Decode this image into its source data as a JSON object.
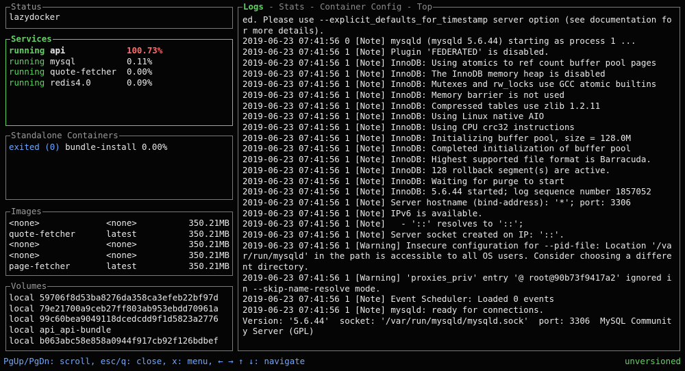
{
  "status": {
    "title": "Status",
    "project": "lazydocker"
  },
  "services": {
    "title": "Services",
    "rows": [
      {
        "state": "running",
        "name": "api",
        "cpu": "100.73%",
        "selected": true
      },
      {
        "state": "running",
        "name": "mysql",
        "cpu": "0.11%"
      },
      {
        "state": "running",
        "name": "quote-fetcher",
        "cpu": "0.00%"
      },
      {
        "state": "running",
        "name": "redis4.0",
        "cpu": "0.09%"
      }
    ]
  },
  "standalone": {
    "title": "Standalone Containers",
    "rows": [
      {
        "state": "exited",
        "code": "(0)",
        "name": "bundle-install",
        "cpu": "0.00%"
      }
    ]
  },
  "images": {
    "title": "Images",
    "rows": [
      {
        "name": "<none>",
        "tag": "<none>",
        "size": "350.21MB"
      },
      {
        "name": "quote-fetcher",
        "tag": "latest",
        "size": "350.21MB"
      },
      {
        "name": "<none>",
        "tag": "<none>",
        "size": "350.21MB"
      },
      {
        "name": "<none>",
        "tag": "<none>",
        "size": "350.21MB"
      },
      {
        "name": "page-fetcher",
        "tag": "latest",
        "size": "350.21MB"
      }
    ]
  },
  "volumes": {
    "title": "Volumes",
    "rows": [
      {
        "driver": "local",
        "name": "59706f8d53ba8276da358ca3efeb22bf97d"
      },
      {
        "driver": "local",
        "name": "79e21700a9ceb27ff803ab953ebdd70961a"
      },
      {
        "driver": "local",
        "name": "99c60bea9049118dcedcdd9f1d5823a2776"
      },
      {
        "driver": "local",
        "name": "api_api-bundle"
      },
      {
        "driver": "local",
        "name": "b063abc58e858a0944f917cb92f126bdbef"
      }
    ]
  },
  "main": {
    "tabs": [
      {
        "label": "Logs",
        "current": true
      },
      {
        "label": "Stats"
      },
      {
        "label": "Container Config"
      },
      {
        "label": "Top"
      }
    ],
    "tab_separator": " - ",
    "log_lines": [
      "ed. Please use --explicit_defaults_for_timestamp server option (see documentation for more details).",
      "2019-06-23 07:41:56 0 [Note] mysqld (mysqld 5.6.44) starting as process 1 ...",
      "2019-06-23 07:41:56 1 [Note] Plugin 'FEDERATED' is disabled.",
      "2019-06-23 07:41:56 1 [Note] InnoDB: Using atomics to ref count buffer pool pages",
      "2019-06-23 07:41:56 1 [Note] InnoDB: The InnoDB memory heap is disabled",
      "2019-06-23 07:41:56 1 [Note] InnoDB: Mutexes and rw_locks use GCC atomic builtins",
      "2019-06-23 07:41:56 1 [Note] InnoDB: Memory barrier is not used",
      "2019-06-23 07:41:56 1 [Note] InnoDB: Compressed tables use zlib 1.2.11",
      "2019-06-23 07:41:56 1 [Note] InnoDB: Using Linux native AIO",
      "2019-06-23 07:41:56 1 [Note] InnoDB: Using CPU crc32 instructions",
      "2019-06-23 07:41:56 1 [Note] InnoDB: Initializing buffer pool, size = 128.0M",
      "2019-06-23 07:41:56 1 [Note] InnoDB: Completed initialization of buffer pool",
      "2019-06-23 07:41:56 1 [Note] InnoDB: Highest supported file format is Barracuda.",
      "2019-06-23 07:41:56 1 [Note] InnoDB: 128 rollback segment(s) are active.",
      "2019-06-23 07:41:56 1 [Note] InnoDB: Waiting for purge to start",
      "2019-06-23 07:41:56 1 [Note] InnoDB: 5.6.44 started; log sequence number 1857052",
      "2019-06-23 07:41:56 1 [Note] Server hostname (bind-address): '*'; port: 3306",
      "2019-06-23 07:41:56 1 [Note] IPv6 is available.",
      "2019-06-23 07:41:56 1 [Note]   - '::' resolves to '::';",
      "2019-06-23 07:41:56 1 [Note] Server socket created on IP: '::'.",
      "2019-06-23 07:41:56 1 [Warning] Insecure configuration for --pid-file: Location '/var/run/mysqld' in the path is accessible to all OS users. Consider choosing a different directory.",
      "2019-06-23 07:41:56 1 [Warning] 'proxies_priv' entry '@ root@90b73f9417a2' ignored in --skip-name-resolve mode.",
      "2019-06-23 07:41:56 1 [Note] Event Scheduler: Loaded 0 events",
      "2019-06-23 07:41:56 1 [Note] mysqld: ready for connections.",
      "Version: '5.6.44'  socket: '/var/run/mysqld/mysqld.sock'  port: 3306  MySQL Community Server (GPL)"
    ]
  },
  "footer": {
    "keybindings": "PgUp/PgDn: scroll, esc/q: close, x: menu, ← → ↑ ↓: navigate",
    "version": "unversioned"
  },
  "colors": {
    "accent": "#5fd35f",
    "link": "#6ea6ff",
    "highlight": "#ff6b6b",
    "border": "#7a7a7a",
    "background": "#050505"
  }
}
